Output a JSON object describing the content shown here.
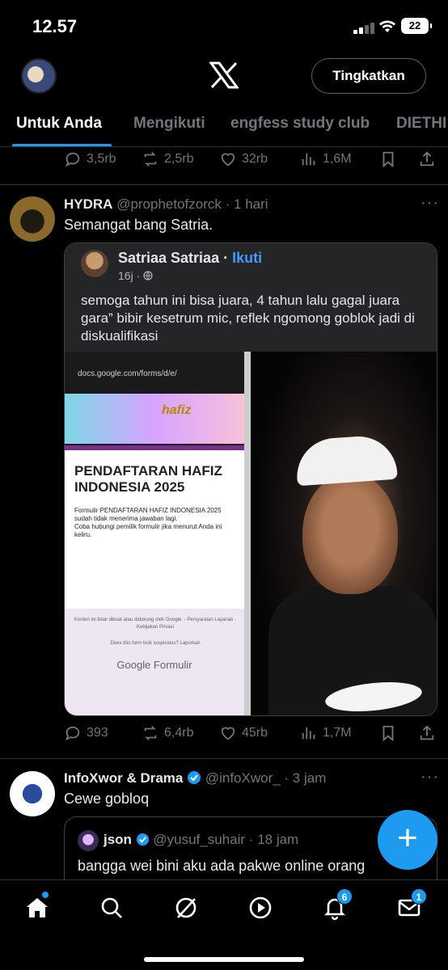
{
  "status_bar": {
    "time": "12.57",
    "battery": "22"
  },
  "header": {
    "upgrade_label": "Tingkatkan",
    "logo_icon": "x-logo-icon"
  },
  "tabs": [
    {
      "label": "Untuk Anda",
      "active": true
    },
    {
      "label": "Mengikuti",
      "active": false
    },
    {
      "label": "engfess study club",
      "active": false
    },
    {
      "label": "DIETHI",
      "active": false
    }
  ],
  "posts": [
    {
      "stats": {
        "replies": "3,5rb",
        "reposts": "2,5rb",
        "likes": "32rb",
        "views": "1,6M"
      }
    },
    {
      "name": "HYDRA",
      "handle": "@prophetofzorck",
      "time": "· 1 hari",
      "text": "Semangat bang Satria.",
      "quote": {
        "author": "Satriaa Satriaa",
        "follow": "Ikuti",
        "time": "16j ·",
        "text": "semoga tahun ini bisa juara, 4 tahun lalu gagal juara gara” bibir kesetrum mic, reflek ngomong goblok jadi di diskualifikasi",
        "form": {
          "url": "docs.google.com/forms/d/e/",
          "banner": "hafiz",
          "title_line1": "PENDAFTARAN HAFIZ",
          "title_line2": "INDONESIA 2025",
          "desc1": "Formulir PENDAFTARAN HAFIZ INDONESIA 2025 sudah tidak menerima jawaban lagi.",
          "desc2": "Coba hubungi pemilik formulir jika menurut Anda ini keliru.",
          "footer": "Konten ini tidak dibuat atau didukung oleh Google. - Persyaratan Layanan - Kebijakan Privasi",
          "suspicious": "Does this form look suspicious? Laporkan",
          "brand": "Google Formulir"
        }
      },
      "stats": {
        "replies": "393",
        "reposts": "6,4rb",
        "likes": "45rb",
        "views": "1,7M"
      }
    },
    {
      "name": "InfoXwor & Drama",
      "handle": "@infoXwor_",
      "time": "· 3 jam",
      "text": "Cewe gobloq",
      "quote": {
        "name": "json",
        "handle": "@yusuf_suhair",
        "time": "· 18 jam",
        "text": "bangga wei bini aku ada pakwe online orang"
      }
    }
  ],
  "nav": {
    "notifications_badge": "6",
    "messages_badge": "1"
  },
  "colors": {
    "accent": "#1d9bf0",
    "background": "#000000",
    "muted": "#71767b"
  }
}
